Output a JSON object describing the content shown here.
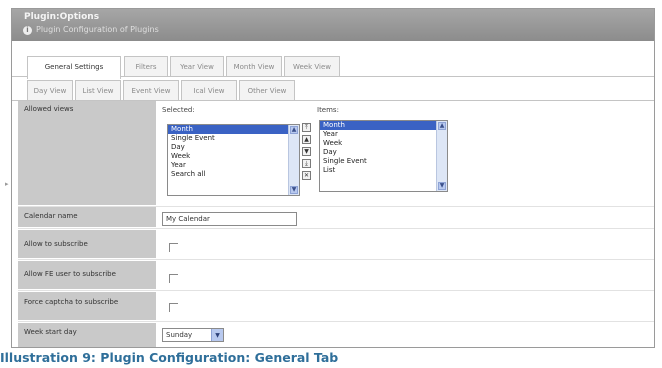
{
  "header": {
    "title": "Plugin:Options",
    "subtitle": "Plugin Configuration of Plugins"
  },
  "tabs_row1": [
    "General Settings",
    "Filters",
    "Year View",
    "Month View",
    "Week View"
  ],
  "tabs_row2": [
    "Day View",
    "List View",
    "Event View",
    "Ical View",
    "Other View"
  ],
  "allowed_views": {
    "label": "Allowed views",
    "selected_label": "Selected:",
    "items_label": "Items:",
    "selected": [
      "Month",
      "Single Event",
      "Day",
      "Week",
      "Year",
      "Search all"
    ],
    "items": [
      "Month",
      "Year",
      "Week",
      "Day",
      "Single Event",
      "List"
    ]
  },
  "calendar_name": {
    "label": "Calendar name",
    "value": "My Calendar"
  },
  "allow_subscribe": {
    "label": "Allow to subscribe"
  },
  "allow_fe_subscribe": {
    "label": "Allow FE user to subscribe"
  },
  "force_captcha": {
    "label": "Force captcha to subscribe"
  },
  "week_start": {
    "label": "Week start day",
    "value": "Sunday"
  },
  "caption": "Illustration 9: Plugin Configuration: General Tab"
}
